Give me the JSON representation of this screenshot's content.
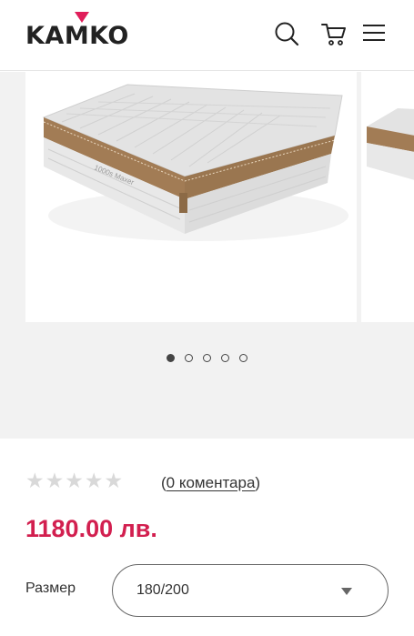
{
  "header": {
    "logo_text": "KAMKO",
    "icons": [
      "search-icon",
      "cart-icon",
      "menu-icon"
    ],
    "accent_color": "#e01e5a"
  },
  "gallery": {
    "slide_count": 5,
    "active_index": 0,
    "mattress_brand_text": "1000s Maxer"
  },
  "product": {
    "rating_stars": 5,
    "rating_value": 0,
    "reviews_open": "(",
    "reviews_text": "0 коментара",
    "reviews_close": ")",
    "price": "1180.00 лв.",
    "price_color": "#d21f4f",
    "size_label": "Размер",
    "size_value": "180/200"
  }
}
